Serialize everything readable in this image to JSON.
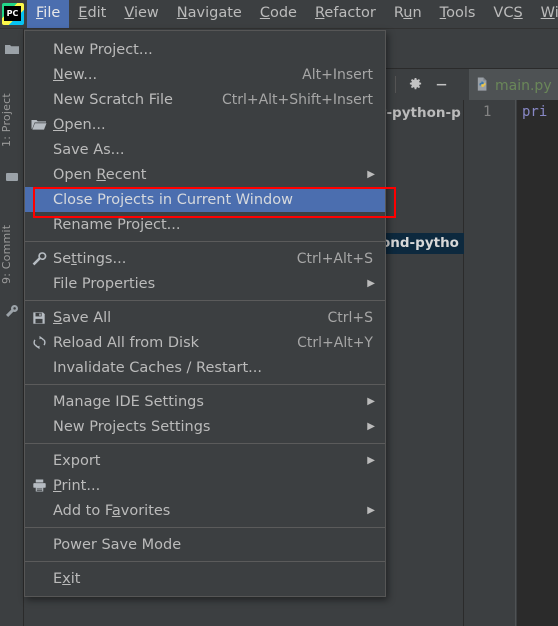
{
  "app": {
    "name": "PyCharm",
    "logo_text": "PC",
    "theme_bg": "#3c3f41",
    "accent_selection": "#4b6eaf",
    "annotation_color": "#ff0000"
  },
  "menubar": {
    "items": [
      {
        "label": "File",
        "mnemonic": "F",
        "active": true
      },
      {
        "label": "Edit",
        "mnemonic": "E",
        "active": false
      },
      {
        "label": "View",
        "mnemonic": "V",
        "active": false
      },
      {
        "label": "Navigate",
        "mnemonic": "N",
        "active": false
      },
      {
        "label": "Code",
        "mnemonic": "C",
        "active": false
      },
      {
        "label": "Refactor",
        "mnemonic": "R",
        "active": false
      },
      {
        "label": "Run",
        "mnemonic": "u",
        "active": false
      },
      {
        "label": "Tools",
        "mnemonic": "T",
        "active": false
      },
      {
        "label": "VCS",
        "mnemonic": "S",
        "active": false
      },
      {
        "label": "Wind",
        "mnemonic": "W",
        "active": false
      }
    ]
  },
  "file_menu": {
    "title": "File",
    "groups": [
      {
        "items": [
          {
            "label": "New Project...",
            "accel": "",
            "icon": "",
            "submenu": false,
            "selected": false
          },
          {
            "label": "New...",
            "accel": "Alt+Insert",
            "icon": "",
            "submenu": false,
            "selected": false
          },
          {
            "label": "New Scratch File",
            "accel": "Ctrl+Alt+Shift+Insert",
            "icon": "",
            "submenu": false,
            "selected": false
          },
          {
            "label": "Open...",
            "accel": "",
            "icon": "folder-icon",
            "submenu": false,
            "selected": false
          },
          {
            "label": "Save As...",
            "accel": "",
            "icon": "",
            "submenu": false,
            "selected": false
          },
          {
            "label": "Open Recent",
            "accel": "",
            "icon": "",
            "submenu": true,
            "selected": false
          },
          {
            "label": "Close Projects in Current Window",
            "accel": "",
            "icon": "",
            "submenu": false,
            "selected": true
          },
          {
            "label": "Rename Project...",
            "accel": "",
            "icon": "",
            "submenu": false,
            "selected": false
          }
        ]
      },
      {
        "items": [
          {
            "label": "Settings...",
            "accel": "Ctrl+Alt+S",
            "icon": "wrench-icon",
            "submenu": false,
            "selected": false
          },
          {
            "label": "File Properties",
            "accel": "",
            "icon": "",
            "submenu": true,
            "selected": false
          }
        ]
      },
      {
        "items": [
          {
            "label": "Save All",
            "accel": "Ctrl+S",
            "icon": "save-icon",
            "submenu": false,
            "selected": false
          },
          {
            "label": "Reload All from Disk",
            "accel": "Ctrl+Alt+Y",
            "icon": "refresh-icon",
            "submenu": false,
            "selected": false
          },
          {
            "label": "Invalidate Caches / Restart...",
            "accel": "",
            "icon": "",
            "submenu": false,
            "selected": false
          }
        ]
      },
      {
        "items": [
          {
            "label": "Manage IDE Settings",
            "accel": "",
            "icon": "",
            "submenu": true,
            "selected": false
          },
          {
            "label": "New Projects Settings",
            "accel": "",
            "icon": "",
            "submenu": true,
            "selected": false
          }
        ]
      },
      {
        "items": [
          {
            "label": "Export",
            "accel": "",
            "icon": "",
            "submenu": true,
            "selected": false
          },
          {
            "label": "Print...",
            "accel": "",
            "icon": "printer-icon",
            "submenu": false,
            "selected": false
          },
          {
            "label": "Add to Favorites",
            "accel": "",
            "icon": "",
            "submenu": true,
            "selected": false
          }
        ]
      },
      {
        "items": [
          {
            "label": "Power Save Mode",
            "accel": "",
            "icon": "",
            "submenu": false,
            "selected": false
          }
        ]
      },
      {
        "items": [
          {
            "label": "Exit",
            "accel": "",
            "icon": "",
            "submenu": false,
            "selected": false
          }
        ]
      }
    ]
  },
  "tool_windows": {
    "left_tabs": [
      {
        "label": "1: Project"
      },
      {
        "label": "9: Commit"
      }
    ]
  },
  "project_panel": {
    "toolbar_icons": [
      "gear-icon",
      "minimize-icon"
    ],
    "tree_items": [
      {
        "label": "t-python-p",
        "selected": false
      },
      {
        "label": "ond-pytho",
        "selected": true
      }
    ]
  },
  "editor": {
    "tab": {
      "label": "main.py",
      "icon": "python-file-icon"
    },
    "gutter_line_number": "1",
    "code_fragment": "pri"
  }
}
